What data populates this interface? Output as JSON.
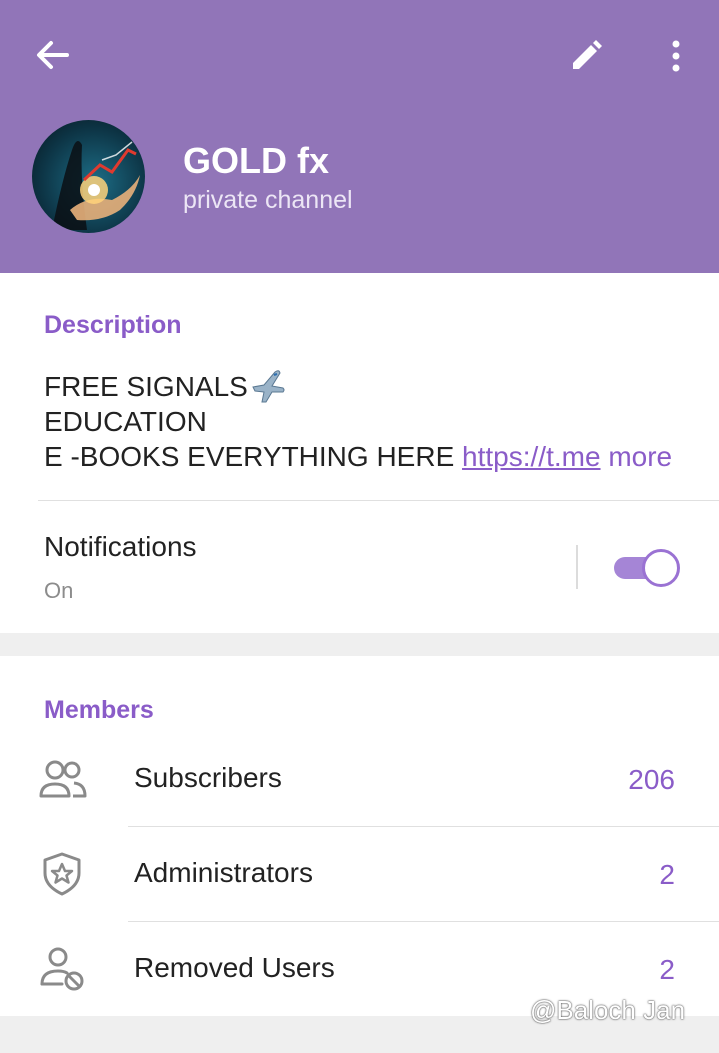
{
  "header": {
    "back_icon": "arrow-left-icon",
    "edit_icon": "pencil-icon",
    "more_icon": "more-vertical-icon",
    "title": "GOLD fx",
    "subtitle": "private channel",
    "color": "#9175b8"
  },
  "description": {
    "heading": "Description",
    "line1": "FREE SIGNALS",
    "line1_emoji": "airplane-emoji",
    "line2": "EDUCATION",
    "line3": "E -BOOKS EVERYTHING HERE ",
    "link": "https://t.me",
    "more": "more"
  },
  "notifications": {
    "label": "Notifications",
    "state": "On",
    "enabled": true
  },
  "members": {
    "heading": "Members",
    "rows": [
      {
        "label": "Subscribers",
        "count": "206",
        "icon": "people-icon"
      },
      {
        "label": "Administrators",
        "count": "2",
        "icon": "shield-star-icon"
      },
      {
        "label": "Removed Users",
        "count": "2",
        "icon": "user-blocked-icon"
      }
    ]
  },
  "watermark": "@Baloch Jan",
  "accent": "#8a5cc8"
}
